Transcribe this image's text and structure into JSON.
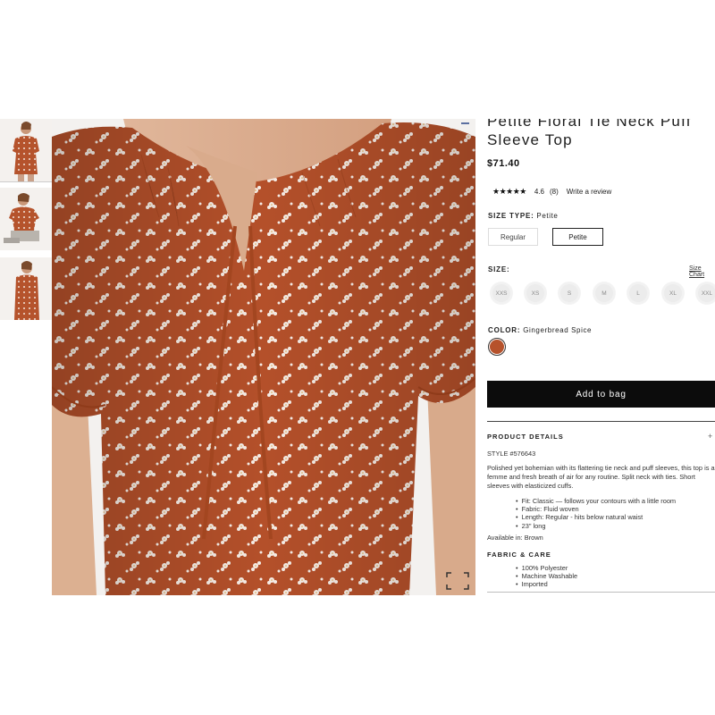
{
  "product": {
    "title": "Petite Floral Tie Neck Puff Sleeve Top",
    "price": "$71.40",
    "rating_stars": "★★★★★",
    "rating_value": "4.6",
    "rating_count": "(8)",
    "write_review": "Write a review"
  },
  "size_type": {
    "label": "SIZE TYPE:",
    "value": "Petite",
    "options": [
      "Regular",
      "Petite"
    ]
  },
  "size": {
    "label": "SIZE:",
    "chart_link": "Size Chart",
    "options": [
      "XXS",
      "XS",
      "S",
      "M",
      "L",
      "XL",
      "XXL"
    ]
  },
  "color": {
    "label": "COLOR:",
    "value": "Gingerbread Spice",
    "swatch_hex": "#b6522b"
  },
  "add_to_bag": "Add to bag",
  "details": {
    "heading": "PRODUCT DETAILS",
    "toggle": "+",
    "style": "STYLE #576643",
    "description": "Polished yet bohemian with its flattering tie neck and puff sleeves, this top is a femme and fresh breath of air for any routine. Split neck with ties. Short sleeves with elasticized cuffs.",
    "bullets": [
      "Fit: Classic — follows your contours with a little room",
      "Fabric: Fluid woven",
      "Length: Regular - hits below natural waist",
      "23\" long"
    ],
    "available": "Available in: Brown"
  },
  "fabric": {
    "heading": "FABRIC & CARE",
    "bullets": [
      "100% Polyester",
      "Machine Washable",
      "Imported"
    ]
  },
  "icons": {
    "expand": "expand-icon",
    "collapse": "minus-icon",
    "plus": "plus-icon"
  }
}
